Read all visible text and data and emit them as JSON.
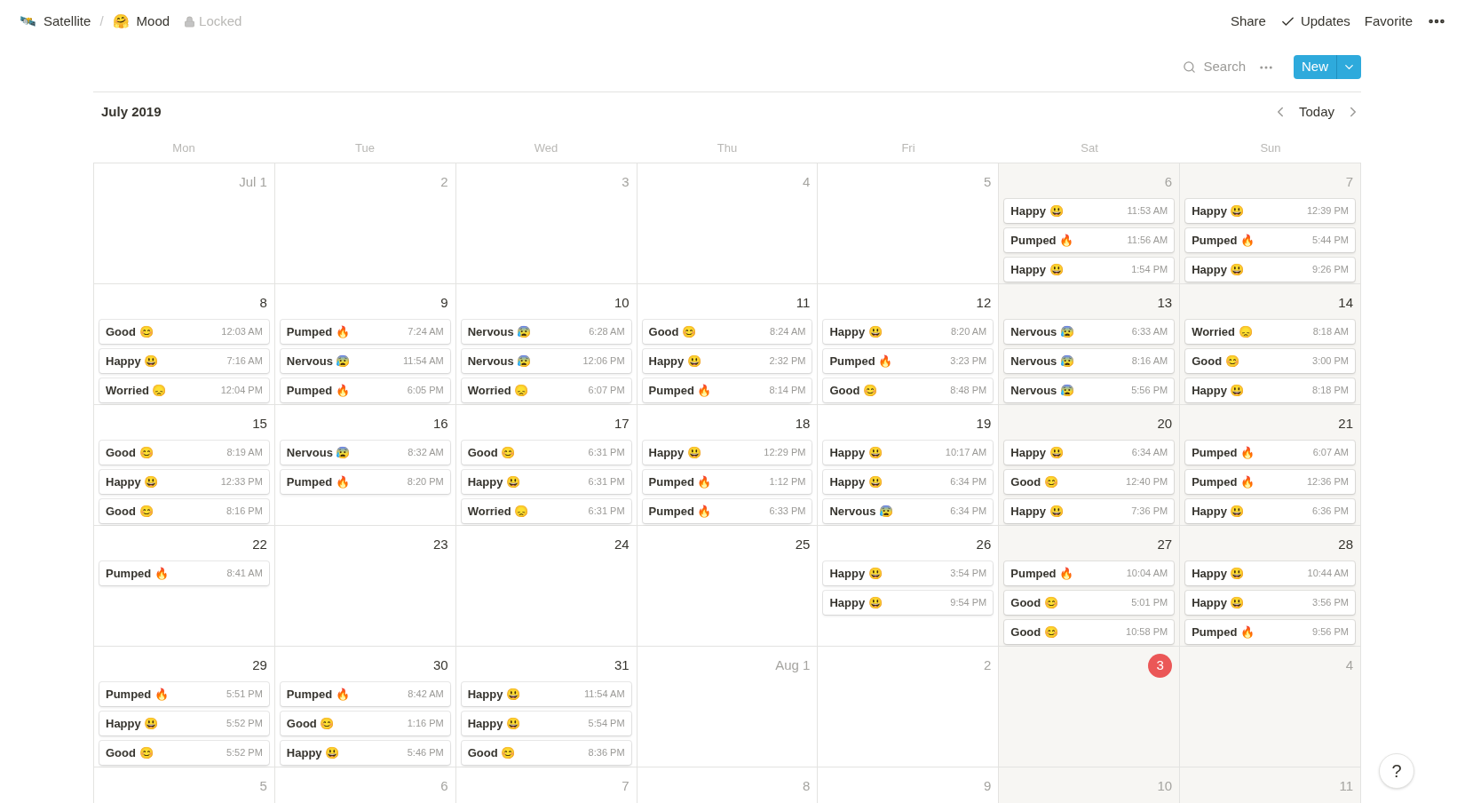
{
  "breadcrumb": [
    {
      "icon": "🛰️",
      "label": "Satellite"
    },
    {
      "icon": "🤗",
      "label": "Mood"
    }
  ],
  "separator": "/",
  "lock_label": "Locked",
  "top_actions": {
    "share": "Share",
    "updates": "Updates",
    "favorite": "Favorite"
  },
  "toolbar": {
    "search": "Search",
    "new_button": "New"
  },
  "calendar": {
    "month": "July 2019",
    "today_button": "Today",
    "weekdays": [
      {
        "label": "Mon",
        "weekend": false
      },
      {
        "label": "Tue",
        "weekend": false
      },
      {
        "label": "Wed",
        "weekend": false
      },
      {
        "label": "Thu",
        "weekend": false
      },
      {
        "label": "Fri",
        "weekend": false
      },
      {
        "label": "Sat",
        "weekend": true
      },
      {
        "label": "Sun",
        "weekend": true
      }
    ],
    "weeks": [
      [
        {
          "label": "Jul 1",
          "dimmed": true
        },
        {
          "label": "2",
          "dimmed": true
        },
        {
          "label": "3",
          "dimmed": true
        },
        {
          "label": "4",
          "dimmed": true
        },
        {
          "label": "5",
          "dimmed": true
        },
        {
          "label": "6",
          "dimmed": true,
          "events": [
            {
              "title": "Happy 😃",
              "time": "11:53 AM"
            },
            {
              "title": "Pumped 🔥",
              "time": "11:56 AM"
            },
            {
              "title": "Happy 😃",
              "time": "1:54 PM"
            }
          ]
        },
        {
          "label": "7",
          "dimmed": true,
          "events": [
            {
              "title": "Happy 😃",
              "time": "12:39 PM"
            },
            {
              "title": "Pumped 🔥",
              "time": "5:44 PM"
            },
            {
              "title": "Happy 😃",
              "time": "9:26 PM"
            }
          ]
        }
      ],
      [
        {
          "label": "8",
          "events": [
            {
              "title": "Good 😊",
              "time": "12:03 AM"
            },
            {
              "title": "Happy 😃",
              "time": "7:16 AM"
            },
            {
              "title": "Worried 😞",
              "time": "12:04 PM"
            }
          ]
        },
        {
          "label": "9",
          "events": [
            {
              "title": "Pumped 🔥",
              "time": "7:24 AM"
            },
            {
              "title": "Nervous 😰",
              "time": "11:54 AM"
            },
            {
              "title": "Pumped 🔥",
              "time": "6:05 PM"
            }
          ]
        },
        {
          "label": "10",
          "events": [
            {
              "title": "Nervous 😰",
              "time": "6:28 AM"
            },
            {
              "title": "Nervous 😰",
              "time": "12:06 PM"
            },
            {
              "title": "Worried 😞",
              "time": "6:07 PM"
            }
          ]
        },
        {
          "label": "11",
          "events": [
            {
              "title": "Good 😊",
              "time": "8:24 AM"
            },
            {
              "title": "Happy 😃",
              "time": "2:32 PM"
            },
            {
              "title": "Pumped 🔥",
              "time": "8:14 PM"
            }
          ]
        },
        {
          "label": "12",
          "events": [
            {
              "title": "Happy 😃",
              "time": "8:20 AM"
            },
            {
              "title": "Pumped 🔥",
              "time": "3:23 PM"
            },
            {
              "title": "Good 😊",
              "time": "8:48 PM"
            }
          ]
        },
        {
          "label": "13",
          "events": [
            {
              "title": "Nervous 😰",
              "time": "6:33 AM"
            },
            {
              "title": "Nervous 😰",
              "time": "8:16 AM"
            },
            {
              "title": "Nervous 😰",
              "time": "5:56 PM"
            }
          ]
        },
        {
          "label": "14",
          "events": [
            {
              "title": "Worried 😞",
              "time": "8:18 AM"
            },
            {
              "title": "Good 😊",
              "time": "3:00 PM"
            },
            {
              "title": "Happy 😃",
              "time": "8:18 PM"
            }
          ]
        }
      ],
      [
        {
          "label": "15",
          "events": [
            {
              "title": "Good 😊",
              "time": "8:19 AM"
            },
            {
              "title": "Happy 😃",
              "time": "12:33 PM"
            },
            {
              "title": "Good 😊",
              "time": "8:16 PM"
            }
          ]
        },
        {
          "label": "16",
          "events": [
            {
              "title": "Nervous 😰",
              "time": "8:32 AM"
            },
            {
              "title": "Pumped 🔥",
              "time": "8:20 PM"
            }
          ]
        },
        {
          "label": "17",
          "events": [
            {
              "title": "Good 😊",
              "time": "6:31 PM"
            },
            {
              "title": "Happy 😃",
              "time": "6:31 PM"
            },
            {
              "title": "Worried 😞",
              "time": "6:31 PM"
            }
          ]
        },
        {
          "label": "18",
          "events": [
            {
              "title": "Happy 😃",
              "time": "12:29 PM"
            },
            {
              "title": "Pumped 🔥",
              "time": "1:12 PM"
            },
            {
              "title": "Pumped 🔥",
              "time": "6:33 PM"
            }
          ]
        },
        {
          "label": "19",
          "events": [
            {
              "title": "Happy 😃",
              "time": "10:17 AM"
            },
            {
              "title": "Happy 😃",
              "time": "6:34 PM"
            },
            {
              "title": "Nervous 😰",
              "time": "6:34 PM"
            }
          ]
        },
        {
          "label": "20",
          "events": [
            {
              "title": "Happy 😃",
              "time": "6:34 AM"
            },
            {
              "title": "Good 😊",
              "time": "12:40 PM"
            },
            {
              "title": "Happy 😃",
              "time": "7:36 PM"
            }
          ]
        },
        {
          "label": "21",
          "events": [
            {
              "title": "Pumped 🔥",
              "time": "6:07 AM"
            },
            {
              "title": "Pumped 🔥",
              "time": "12:36 PM"
            },
            {
              "title": "Happy 😃",
              "time": "6:36 PM"
            }
          ]
        }
      ],
      [
        {
          "label": "22",
          "events": [
            {
              "title": "Pumped 🔥",
              "time": "8:41 AM"
            }
          ]
        },
        {
          "label": "23"
        },
        {
          "label": "24"
        },
        {
          "label": "25"
        },
        {
          "label": "26",
          "events": [
            {
              "title": "Happy 😃",
              "time": "3:54 PM"
            },
            {
              "title": "Happy 😃",
              "time": "9:54 PM"
            }
          ]
        },
        {
          "label": "27",
          "events": [
            {
              "title": "Pumped 🔥",
              "time": "10:04 AM"
            },
            {
              "title": "Good 😊",
              "time": "5:01 PM"
            },
            {
              "title": "Good 😊",
              "time": "10:58 PM"
            }
          ]
        },
        {
          "label": "28",
          "events": [
            {
              "title": "Happy 😃",
              "time": "10:44 AM"
            },
            {
              "title": "Happy 😃",
              "time": "3:56 PM"
            },
            {
              "title": "Pumped 🔥",
              "time": "9:56 PM"
            }
          ]
        }
      ],
      [
        {
          "label": "29",
          "events": [
            {
              "title": "Pumped 🔥",
              "time": "5:51 PM"
            },
            {
              "title": "Happy 😃",
              "time": "5:52 PM"
            },
            {
              "title": "Good 😊",
              "time": "5:52 PM"
            }
          ]
        },
        {
          "label": "30",
          "events": [
            {
              "title": "Pumped 🔥",
              "time": "8:42 AM"
            },
            {
              "title": "Good 😊",
              "time": "1:16 PM"
            },
            {
              "title": "Happy 😃",
              "time": "5:46 PM"
            }
          ]
        },
        {
          "label": "31",
          "events": [
            {
              "title": "Happy 😃",
              "time": "11:54 AM"
            },
            {
              "title": "Happy 😃",
              "time": "5:54 PM"
            },
            {
              "title": "Good 😊",
              "time": "8:36 PM"
            }
          ]
        },
        {
          "label": "Aug 1",
          "dimmed": true
        },
        {
          "label": "2",
          "dimmed": true
        },
        {
          "label": "3",
          "today": true
        },
        {
          "label": "4",
          "dimmed": true
        }
      ],
      [
        {
          "label": "5",
          "dimmed": true
        },
        {
          "label": "6",
          "dimmed": true
        },
        {
          "label": "7",
          "dimmed": true
        },
        {
          "label": "8",
          "dimmed": true
        },
        {
          "label": "9",
          "dimmed": true
        },
        {
          "label": "10",
          "dimmed": true
        },
        {
          "label": "11",
          "dimmed": true
        }
      ]
    ]
  },
  "help_button": "?"
}
